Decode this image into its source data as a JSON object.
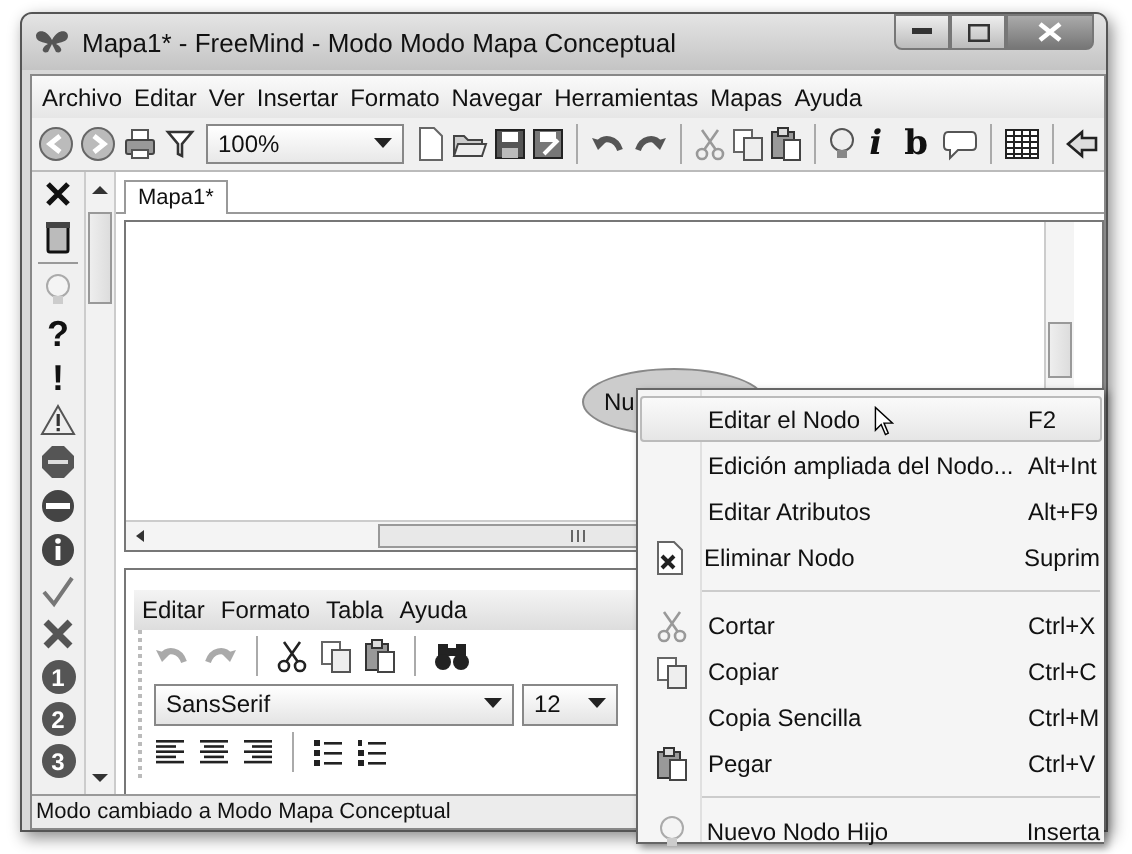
{
  "window": {
    "title": "Mapa1* - FreeMind - Modo Modo Mapa Conceptual"
  },
  "menu_bar": [
    "Archivo",
    "Editar",
    "Ver",
    "Insertar",
    "Formato",
    "Navegar",
    "Herramientas",
    "Mapas",
    "Ayuda"
  ],
  "toolbar": {
    "zoom": "100%",
    "glyph_buttons": [
      "i",
      "b"
    ]
  },
  "icon_rail": [
    {
      "kind": "close"
    },
    {
      "kind": "trash"
    },
    {
      "kind": "bulb"
    },
    {
      "kind": "glyph",
      "label": "?"
    },
    {
      "kind": "glyph",
      "label": "!"
    },
    {
      "kind": "warning"
    },
    {
      "kind": "stop"
    },
    {
      "kind": "minus"
    },
    {
      "kind": "info"
    },
    {
      "kind": "check"
    },
    {
      "kind": "cross"
    },
    {
      "kind": "number",
      "label": "1"
    },
    {
      "kind": "number",
      "label": "2"
    },
    {
      "kind": "number",
      "label": "3"
    }
  ],
  "tabs": [
    {
      "label": "Mapa1*",
      "selected": true
    }
  ],
  "map": {
    "node": "Nu"
  },
  "editor": {
    "menu": [
      "Editar",
      "Formato",
      "Tabla",
      "Ayuda"
    ],
    "font": "SansSerif",
    "size": "12"
  },
  "context_menu": {
    "items": [
      {
        "kind": "item",
        "label": "Editar el Nodo",
        "shortcut": "F2",
        "selected": true
      },
      {
        "kind": "item",
        "label": "Edición ampliada del Nodo...",
        "shortcut": "Alt+Int",
        "selected": false
      },
      {
        "kind": "item",
        "label": "Editar Atributos",
        "shortcut": "Alt+F9",
        "selected": false
      },
      {
        "kind": "item",
        "label": "Eliminar Nodo",
        "shortcut": "Suprim",
        "selected": false
      },
      {
        "kind": "separator"
      },
      {
        "kind": "item",
        "label": "Cortar",
        "shortcut": "Ctrl+X",
        "selected": false
      },
      {
        "kind": "item",
        "label": "Copiar",
        "shortcut": "Ctrl+C",
        "selected": false
      },
      {
        "kind": "item",
        "label": "Copia Sencilla",
        "shortcut": "Ctrl+M",
        "selected": false
      },
      {
        "kind": "item",
        "label": "Pegar",
        "shortcut": "Ctrl+V",
        "selected": false
      },
      {
        "kind": "separator"
      },
      {
        "kind": "item",
        "label": "Nuevo Nodo Hijo",
        "shortcut": "Inserta",
        "selected": false
      }
    ]
  },
  "status_bar": "Modo cambiado a Modo Mapa Conceptual"
}
